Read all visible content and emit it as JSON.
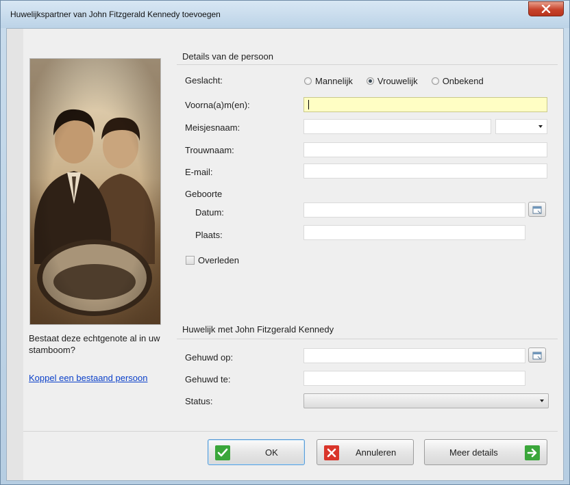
{
  "window": {
    "title": "Huwelijkspartner van John Fitzgerald Kennedy toevoegen"
  },
  "side": {
    "question": "Bestaat deze echtgenote al in uw stamboom?",
    "link": "Koppel een bestaand persoon"
  },
  "person": {
    "section_title": "Details van de persoon",
    "gender_label": "Geslacht:",
    "gender_options": [
      {
        "label": "Mannelijk",
        "checked": false
      },
      {
        "label": "Vrouwelijk",
        "checked": true
      },
      {
        "label": "Onbekend",
        "checked": false
      }
    ],
    "first_names_label": "Voorna(a)m(en):",
    "first_names_value": "",
    "maiden_name_label": "Meisjesnaam:",
    "maiden_name_value": "",
    "married_name_label": "Trouwnaam:",
    "married_name_value": "",
    "email_label": "E-mail:",
    "email_value": "",
    "birth_label": "Geboorte",
    "birth_date_label": "Datum:",
    "birth_date_value": "",
    "birth_place_label": "Plaats:",
    "birth_place_value": "",
    "deceased_label": "Overleden",
    "deceased_checked": false
  },
  "marriage": {
    "section_title": "Huwelijk met John Fitzgerald Kennedy",
    "married_on_label": "Gehuwd op:",
    "married_on_value": "",
    "married_at_label": "Gehuwd te:",
    "married_at_value": "",
    "status_label": "Status:",
    "status_value": ""
  },
  "buttons": {
    "ok": "OK",
    "cancel": "Annuleren",
    "more": "Meer details"
  },
  "colors": {
    "focused_field": "#fffec4",
    "link": "#0b40c9",
    "ok_icon": "#3aa63a",
    "cancel_icon": "#d9352a",
    "more_icon": "#3aa63a"
  }
}
